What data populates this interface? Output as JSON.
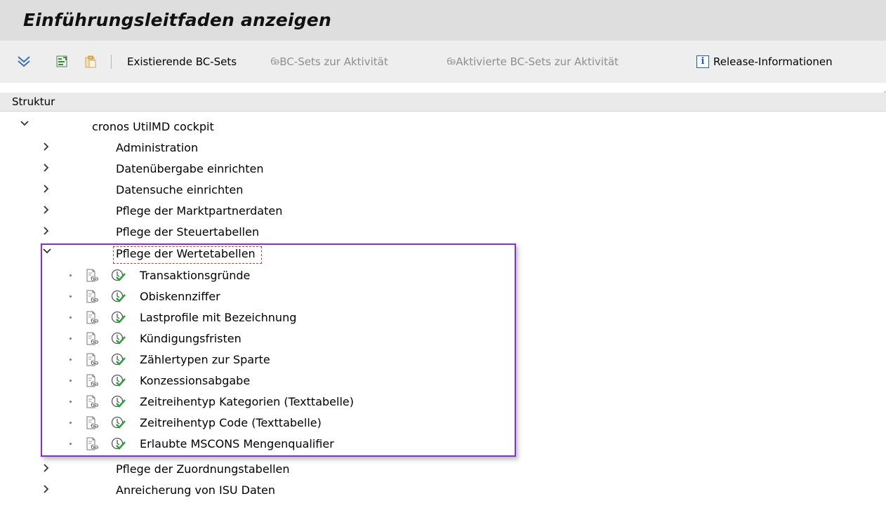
{
  "page": {
    "title": "Einführungsleitfaden anzeigen"
  },
  "toolbar": {
    "icons": [
      "expand-icon",
      "find-icon",
      "clipboard-icon"
    ],
    "existing_bc_sets": "Existierende BC-Sets",
    "bc_sets_activity": "BC-Sets zur Aktivität",
    "activated_bc_sets_activity": "Aktivierte BC-Sets zur Aktivität",
    "release_info": "Release-Informationen"
  },
  "structure": {
    "header": "Struktur",
    "root": {
      "label": "cronos UtilMD cockpit",
      "expanded": true
    },
    "nodes": [
      {
        "label": "Administration",
        "expanded": false
      },
      {
        "label": "Datenübergabe einrichten",
        "expanded": false
      },
      {
        "label": "Datensuche einrichten",
        "expanded": false
      },
      {
        "label": "Pflege der Marktpartnerdaten",
        "expanded": false
      },
      {
        "label": "Pflege der Steuertabellen",
        "expanded": false
      },
      {
        "label": "Pflege der Wertetabellen",
        "expanded": true
      },
      {
        "label": "Pflege der Zuordnungstabellen",
        "expanded": false
      },
      {
        "label": "Anreicherung von ISU Daten",
        "expanded": false
      }
    ],
    "activities": [
      "Transaktionsgründe",
      "Obiskennziffer",
      "Lastprofile mit Bezeichnung",
      "Kündigungsfristen",
      "Zählertypen zur Sparte",
      "Konzessionsabgabe",
      "Zeitreihentyp Kategorien (Texttabelle)",
      "Zeitreihentyp Code (Texttabelle)",
      "Erlaubte MSCONS Mengenqualifier"
    ]
  },
  "colors": {
    "highlight_border": "#8a2be2",
    "focus_border": "#dd3333",
    "info_blue": "#1a5fb4",
    "exec_green": "#2e9e3e"
  }
}
